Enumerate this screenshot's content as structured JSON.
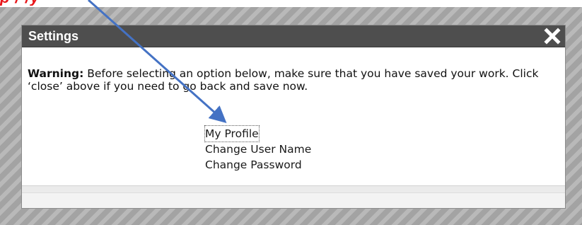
{
  "annotation": {
    "caption_fragment": "p / /y",
    "arrow_color": "#4472c4",
    "caption_color": "#e8161a"
  },
  "dialog": {
    "title": "Settings",
    "close_icon": "close-x-icon",
    "warning_label": "Warning:",
    "warning_text": " Before selecting an option below, make sure that you have saved your work. Click ‘close’ above if you need to go back and save now.",
    "options": [
      {
        "label": "My Profile",
        "focused": true
      },
      {
        "label": "Change User Name",
        "focused": false
      },
      {
        "label": "Change Password",
        "focused": false
      }
    ],
    "titlebar_color": "#4e4e4e"
  }
}
